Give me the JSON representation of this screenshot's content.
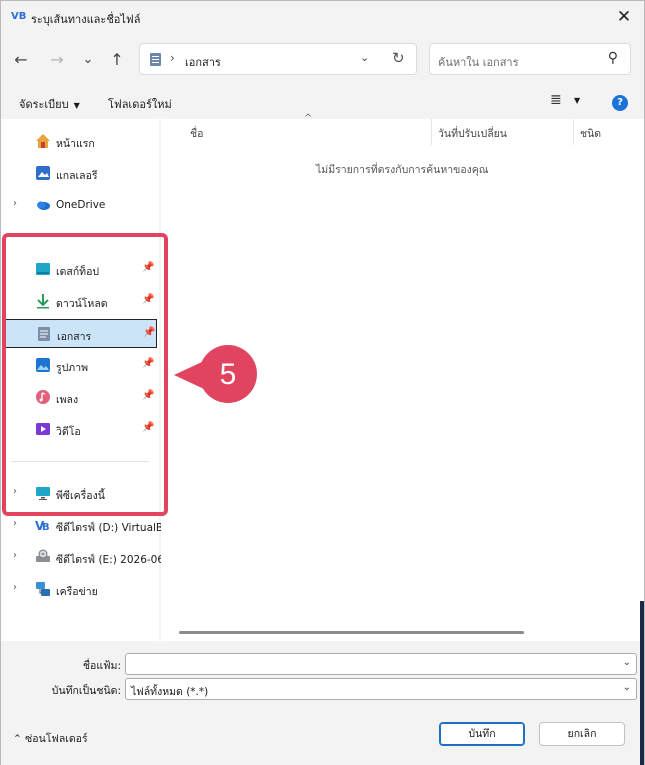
{
  "window": {
    "title": "ระบุเส้นทางและชื่อไฟล์",
    "app_logo": "VB",
    "close": "✕"
  },
  "nav": {
    "back": "←",
    "forward": "→",
    "recent": "⌄",
    "up": "↑"
  },
  "address": {
    "separator": "›",
    "path": "เอกสาร",
    "dropdown": "⌄",
    "refresh": "↻"
  },
  "search": {
    "placeholder": "ค้นหาใน เอกสาร",
    "icon": "⚲"
  },
  "toolbar": {
    "organize": "จัดระเบียบ",
    "new_folder": "โฟลเดอร์ใหม่",
    "view_icon": "≣",
    "caret": "▼",
    "help": "?"
  },
  "sidebar": {
    "items": [
      {
        "label": "หน้าแรก",
        "icon": "home-icon"
      },
      {
        "label": "แกลเลอรี",
        "icon": "gallery-icon"
      },
      {
        "label": "OneDrive",
        "icon": "cloud-icon",
        "chevron": "›"
      },
      {
        "label": "เดสก์ท็อป",
        "icon": "desktop-icon",
        "pin": "📌"
      },
      {
        "label": "ดาวน์โหลด",
        "icon": "download-icon",
        "pin": "📌"
      },
      {
        "label": "เอกสาร",
        "icon": "document-icon",
        "pin": "📌"
      },
      {
        "label": "รูปภาพ",
        "icon": "pictures-icon",
        "pin": "📌"
      },
      {
        "label": "เพลง",
        "icon": "music-icon",
        "pin": "📌"
      },
      {
        "label": "วิดีโอ",
        "icon": "video-icon",
        "pin": "📌"
      },
      {
        "label": "พีซีเครื่องนี้",
        "icon": "monitor-icon",
        "chevron": "›"
      },
      {
        "label": "ซีดีไดรฟ์ (D:) VirtualB",
        "icon": "cd-drive-icon",
        "chevron": "›"
      },
      {
        "label": "ซีดีไดรฟ์ (E:) 2026-06",
        "icon": "disc-drive-icon",
        "chevron": "›"
      },
      {
        "label": "เครือข่าย",
        "icon": "network-icon",
        "chevron": "›"
      }
    ]
  },
  "content": {
    "columns": [
      "ชื่อ",
      "วันที่ปรับเปลี่ยน",
      "ชนิด"
    ],
    "sort_caret": "^",
    "empty_message": "ไม่มีรายการที่ตรงกับการค้นหาของคุณ"
  },
  "form": {
    "filename_label": "ชื่อแฟ้ม:",
    "filename_value": "",
    "filetype_label": "บันทึกเป็นชนิด:",
    "filetype_value": "ไฟล์ทั้งหมด (*.*)",
    "dropdown": "⌄"
  },
  "footer": {
    "hide_folders": "ซ่อนโฟลเดอร์",
    "hide_caret": "⌃",
    "save": "บันทึก",
    "cancel": "ยกเลิก"
  },
  "annotation": {
    "number": "5",
    "color": "#e0445f"
  }
}
